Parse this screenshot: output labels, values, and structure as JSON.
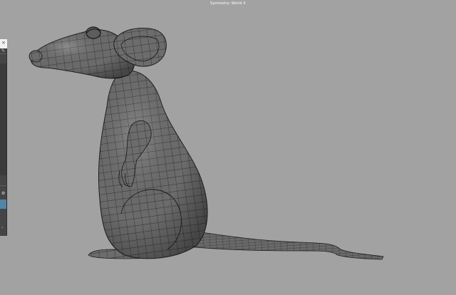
{
  "viewport": {
    "label": "Symmetry: World X",
    "background_color": "#a2a2a2",
    "mesh_fill_color": "#6e6e6e",
    "wire_color": "#1a1a1a"
  },
  "side_panel": {
    "icons": [
      "close-icon",
      "edit-icon",
      "settings-icon",
      "expand-arrow-icon"
    ],
    "highlight_color": "#5285a6"
  }
}
